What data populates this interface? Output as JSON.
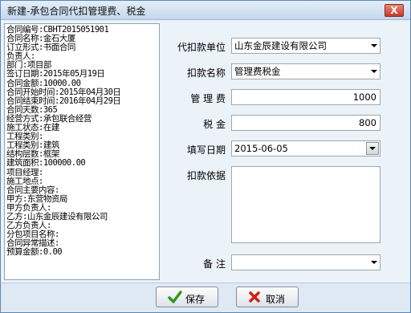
{
  "window": {
    "title": "新建-承包合同代扣管理费、税金",
    "close_label": "X"
  },
  "info_lines": [
    "合同编号:CBHT2015051901",
    "合同名称:金石大厦",
    "订立形式:书面合同",
    "负责人:",
    "部门:项目部",
    "签订日期:2015年05月19日",
    "合同金额:10000.00",
    "合同开始时间:2015年04月30日",
    "合同结束时间:2016年04月29日",
    "合同天数:365",
    "经营方式:承包联合经营",
    "施工状态:在建",
    "工程类别:",
    "工程类别:建筑",
    "结构层数:框架",
    "建筑面积:100000.00",
    "项目经理:",
    "施工地点:",
    "合同主要内容:",
    "甲方:东营物资局",
    "甲方负责人:",
    "乙方:山东金辰建设有限公司",
    "乙方负责人:",
    "分包项目名称:",
    "合同异常描述:",
    "预算金额:0.00"
  ],
  "form": {
    "company_label": "代扣款单位",
    "company_value": "山东金辰建设有限公司",
    "item_label": "扣款名称",
    "item_value": "管理费税金",
    "mgmt_fee_label": "管 理 费",
    "mgmt_fee_value": "1000",
    "tax_label": "税    金",
    "tax_value": "800",
    "date_label": "填写日期",
    "date_value": "2015-06-05",
    "basis_label": "扣款依据",
    "remark_label": "备    注",
    "remark_value": ""
  },
  "buttons": {
    "save_label": "保存",
    "cancel_label": "取消"
  }
}
